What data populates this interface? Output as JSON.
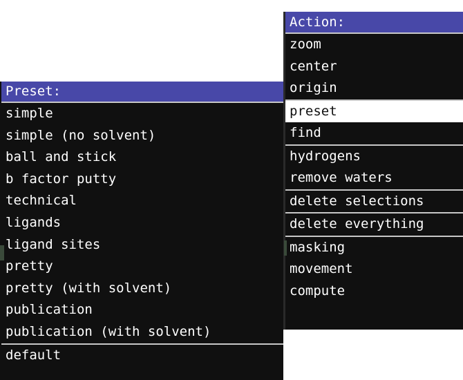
{
  "preset_menu": {
    "title": "Preset:",
    "items": [
      "simple",
      "simple (no solvent)",
      "ball and stick",
      "b factor putty",
      "technical",
      "ligands",
      "ligand sites",
      "pretty",
      "pretty (with solvent)",
      "publication",
      "publication (with solvent)"
    ],
    "default_label": "default"
  },
  "action_menu": {
    "title": "Action:",
    "groups": {
      "view": [
        "zoom",
        "center",
        "origin"
      ],
      "preset": "preset",
      "find": "find",
      "edit": [
        "hydrogens",
        "remove waters"
      ],
      "delete_selections": "delete selections",
      "delete_everything": "delete everything",
      "other": [
        "masking",
        "movement",
        "compute"
      ]
    }
  },
  "colors": {
    "menu_bg": "#101010",
    "title_bg": "#4848a8",
    "text": "#ffffff",
    "separator": "#c8c8c8",
    "selected_bg": "#ffffff"
  }
}
